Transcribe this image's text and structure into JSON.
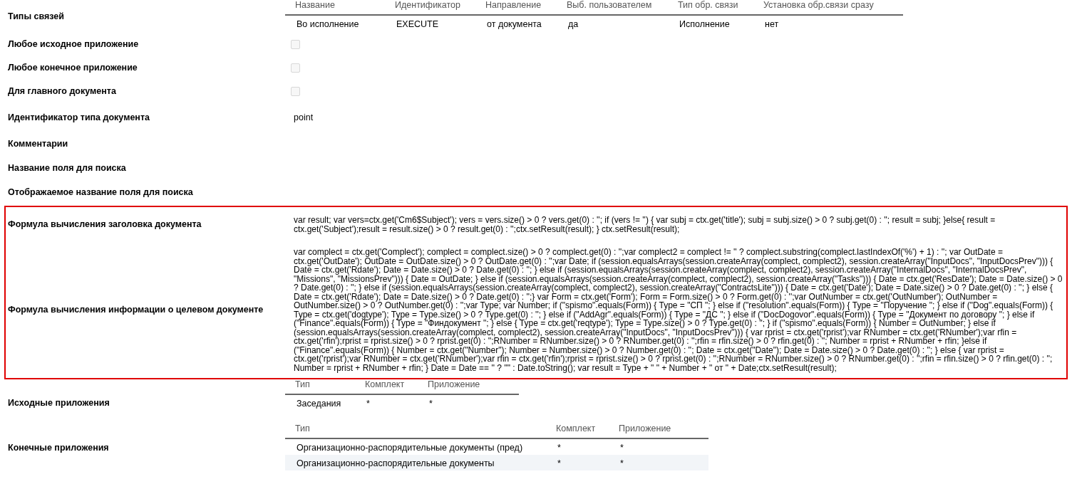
{
  "link_types": {
    "label": "Типы связей",
    "columns": [
      "Название",
      "Идентификатор",
      "Направление",
      "Выб. пользователем",
      "Тип обр. связи",
      "Установка обр.связи сразу"
    ],
    "rows": [
      [
        "Во исполнение",
        "EXECUTE",
        "от документа",
        "да",
        "Исполнение",
        "нет"
      ]
    ]
  },
  "flags": [
    {
      "label": "Любое исходное приложение",
      "checked": false
    },
    {
      "label": "Любое конечное приложение",
      "checked": false
    },
    {
      "label": "Для главного документа",
      "checked": false
    }
  ],
  "fields": [
    {
      "label": "Идентификатор типа документа",
      "value": "point"
    },
    {
      "label": "Комментарии"
    },
    {
      "label": "Название поля для поиска"
    },
    {
      "label": "Отображаемое название поля для поиска"
    }
  ],
  "formulas": [
    {
      "label": "Формула вычисления заголовка документа",
      "code": "var result; var vers=ctx.get('Cm6$Subject'); vers = vers.size() > 0 ? vers.get(0) : ''; if (vers != '') { var subj = ctx.get('title'); subj = subj.size() > 0 ? subj.get(0) : ''; result = subj; }else{ result = ctx.get('Subject');result = result.size() > 0 ? result.get(0) : '';ctx.setResult(result); } ctx.setResult(result);"
    },
    {
      "label": "Формула вычисления информации о целевом документе",
      "code": "var complect = ctx.get('Complect'); complect = complect.size() > 0 ? complect.get(0) : '';var complect2 = complect != '' ? complect.substring(complect.lastIndexOf('%') + 1) : ''; var OutDate = ctx.get('OutDate'); OutDate = OutDate.size() > 0 ? OutDate.get(0) : '';var Date; if (session.equalsArrays(session.createArray(complect, complect2), session.createArray(\"InputDocs\", \"InputDocsPrev\"))) { Date = ctx.get('Rdate'); Date = Date.size() > 0 ? Date.get(0) : ''; } else if (session.equalsArrays(session.createArray(complect, complect2), session.createArray(\"InternalDocs\", \"InternalDocsPrev\", \"Missions\", \"MissionsPrev\"))) { Date = OutDate; } else if (session.equalsArrays(session.createArray(complect, complect2), session.createArray(\"Tasks\"))) { Date = ctx.get('ResDate'); Date = Date.size() > 0 ? Date.get(0) : ''; } else if (session.equalsArrays(session.createArray(complect, complect2), session.createArray(\"ContractsLite\"))) { Date = ctx.get('Date'); Date = Date.size() > 0 ? Date.get(0) : ''; } else { Date = ctx.get('Rdate'); Date = Date.size() > 0 ? Date.get(0) : '';} var Form = ctx.get('Form'); Form = Form.size() > 0 ? Form.get(0) : '';var OutNumber = ctx.get('OutNumber'); OutNumber = OutNumber.size() > 0 ? OutNumber.get(0) : '';var Type; var Number; if (\"spismo\".equals(Form)) { Type = \"СП \"; } else if (\"resolution\".equals(Form)) { Type = \"Поручение \"; } else if (\"Dog\".equals(Form)) { Type = ctx.get('dogtype'); Type = Type.size() > 0 ? Type.get(0) : ''; } else if (\"AddAgr\".equals(Form)) { Type = \"ДС \"; } else if (\"DocDogovor\".equals(Form)) { Type = \"Документ по договору \"; } else if (\"Finance\".equals(Form)) { Type = \"Финдокумент \"; } else { Type = ctx.get('reqtype'); Type = Type.size() > 0 ? Type.get(0) : ''; } if (\"spismo\".equals(Form)) { Number = OutNumber; } else if (session.equalsArrays(session.createArray(complect, complect2), session.createArray(\"InputDocs\", \"InputDocsPrev\"))) { var rprist = ctx.get('rprist');var RNumber = ctx.get('RNumber');var rfin = ctx.get('rfin');rprist = rprist.size() > 0 ? rprist.get(0) : '';RNumber = RNumber.size() > 0 ? RNumber.get(0) : '';rfin = rfin.size() > 0 ? rfin.get(0) : ''; Number = rprist + RNumber + rfin; }else if (\"Finance\".equals(Form)) { Number = ctx.get(\"Number\"); Number = Number.size() > 0 ? Number.get(0) : ''; Date = ctx.get(\"Date\"); Date = Date.size() > 0 ? Date.get(0) : ''; } else { var rprist = ctx.get('rprist');var RNumber = ctx.get('RNumber');var rfin = ctx.get('rfin');rprist = rprist.size() > 0 ? rprist.get(0) : '';RNumber = RNumber.size() > 0 ? RNumber.get(0) : '';rfin = rfin.size() > 0 ? rfin.get(0) : ''; Number = rprist + RNumber + rfin; } Date = Date == '' ? \"\" : Date.toString(); var result = Type + \" \" + Number + \" от \" + Date;ctx.setResult(result);"
    }
  ],
  "source_attachments": {
    "label": "Исходные приложения",
    "columns": [
      "Тип",
      "Комплект",
      "Приложение"
    ],
    "rows": [
      [
        "Заседания",
        "*",
        "*"
      ]
    ]
  },
  "target_attachments": {
    "label": "Конечные приложения",
    "columns": [
      "Тип",
      "Комплект",
      "Приложение"
    ],
    "rows": [
      [
        "Организационно-распорядительные документы (пред)",
        "*",
        "*"
      ],
      [
        "Организационно-распорядительные документы",
        "*",
        "*"
      ]
    ]
  }
}
